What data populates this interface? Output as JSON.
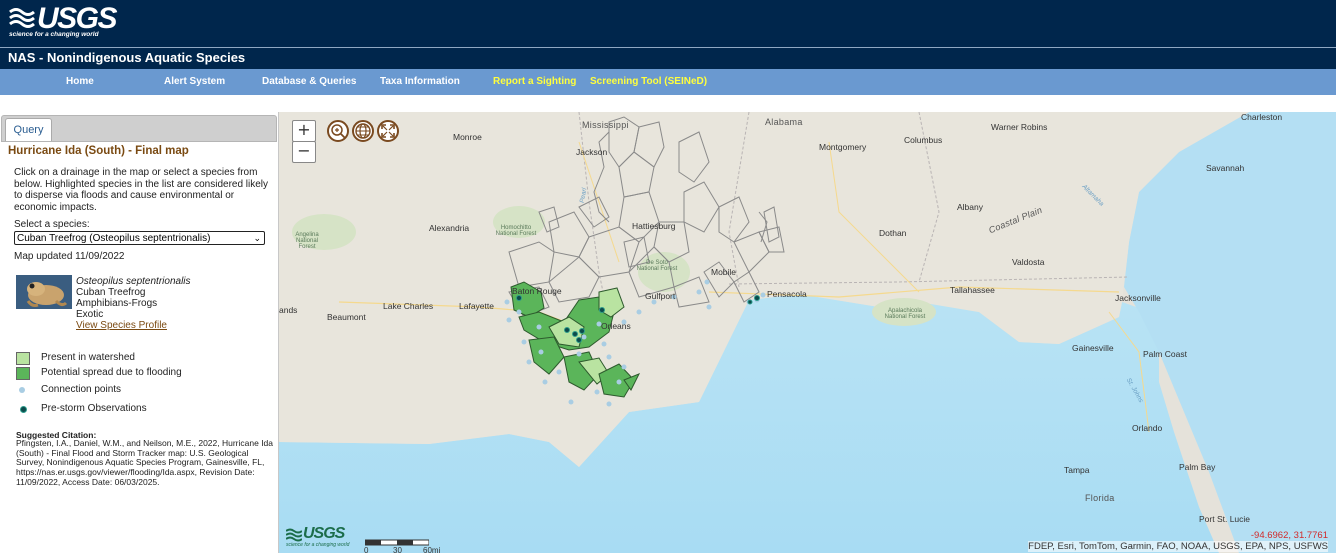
{
  "header": {
    "logo_text": "USGS",
    "logo_tagline": "science for a changing world",
    "site_title": "NAS - Nonindigenous Aquatic Species"
  },
  "nav": [
    {
      "label": "Home",
      "highlight": false
    },
    {
      "label": "Alert System",
      "highlight": false
    },
    {
      "label": "Database & Queries",
      "highlight": false
    },
    {
      "label": "Taxa Information",
      "highlight": false
    },
    {
      "label": "Report a Sighting",
      "highlight": true
    },
    {
      "label": "Screening Tool (SEINeD)",
      "highlight": true
    }
  ],
  "panel": {
    "tab_label": "Query",
    "title": "Hurricane Ida (South) - Final map",
    "description": "Click on a drainage in the map or select a species from below. Highlighted species in the list are considered likely to disperse via floods and cause environmental or economic impacts.",
    "select_label": "Select a species:",
    "selected_species": "Cuban Treefrog (Osteopilus septentrionalis)",
    "map_updated": "Map updated 11/09/2022",
    "species": {
      "scientific": "Osteopilus septentrionalis",
      "common": "Cuban Treefrog",
      "group": "Amphibians-Frogs",
      "status": "Exotic",
      "profile_link": "View Species Profile"
    },
    "legend": [
      {
        "label": "Present in watershed",
        "color": "#b9e3a1"
      },
      {
        "label": "Potential spread due to flooding",
        "color": "#5bb55a"
      },
      {
        "label": "Connection points",
        "color": "#a9cde3"
      },
      {
        "label": "Pre-storm Observations",
        "color": "#0d4b4b"
      }
    ],
    "citation_heading": "Suggested Citation:",
    "citation_text": "Pfingsten, I.A., Daniel, W.M., and Neilson, M.E., 2022, Hurricane Ida (South) - Final Flood and Storm Tracker map: U.S. Geological Survey, Nonindigenous Aquatic Species Program, Gainesville, FL, https://nas.er.usgs.gov/viewer/flooding/Ida.aspx, Revision Date: 11/09/2022, Access Date: 06/03/2025."
  },
  "map": {
    "zoom_in": "+",
    "zoom_out": "−",
    "coordinates": "-94.6962, 31.7761",
    "attribution": "FDEP, Esri, TomTom, Garmin, FAO, NOAA, USGS, EPA, NPS, USFWS",
    "scale_labels": [
      "0",
      "30",
      "60mi"
    ],
    "logo_text": "USGS",
    "logo_tagline": "science for a changing world",
    "places": {
      "monroe": "Monroe",
      "jackson": "Jackson",
      "alabama": "Alabama",
      "mississippi": "Mississippi",
      "montgomery": "Montgomery",
      "columbus": "Columbus",
      "warner_robins": "Warner Robins",
      "charleston": "Charleston",
      "savannah": "Savannah",
      "albany": "Albany",
      "coastal_plain": "Coastal Plain",
      "dothan": "Dothan",
      "valdosta": "Valdosta",
      "alexandria": "Alexandria",
      "hattiesburg": "Hattiesburg",
      "mobile": "Mobile",
      "pensacola": "Pensacola",
      "tallahassee": "Tallahassee",
      "jacksonville": "Jacksonville",
      "lake_charles": "Lake Charles",
      "lafayette": "Lafayette",
      "beaumont": "Beaumont",
      "baton_rouge": "Baton Rouge",
      "gulfport": "Gulfport",
      "new_orleans": "Orleans",
      "gainesville": "Gainesville",
      "palm_coast": "Palm Coast",
      "orlando": "Orlando",
      "tampa": "Tampa",
      "palm_bay": "Palm Bay",
      "florida": "Florida",
      "port_st_lucie": "Port St. Lucie",
      "lands": "ands",
      "pearl": "Pearl",
      "altamaha": "Altamaha",
      "st_johns": "St. Johns"
    },
    "forests": {
      "kisatchie": "Angelina National Forest",
      "homochitto": "Homochitto National Forest",
      "desoto": "De Soto National Forest",
      "apalachicola": "Apalachicola National Forest"
    }
  }
}
